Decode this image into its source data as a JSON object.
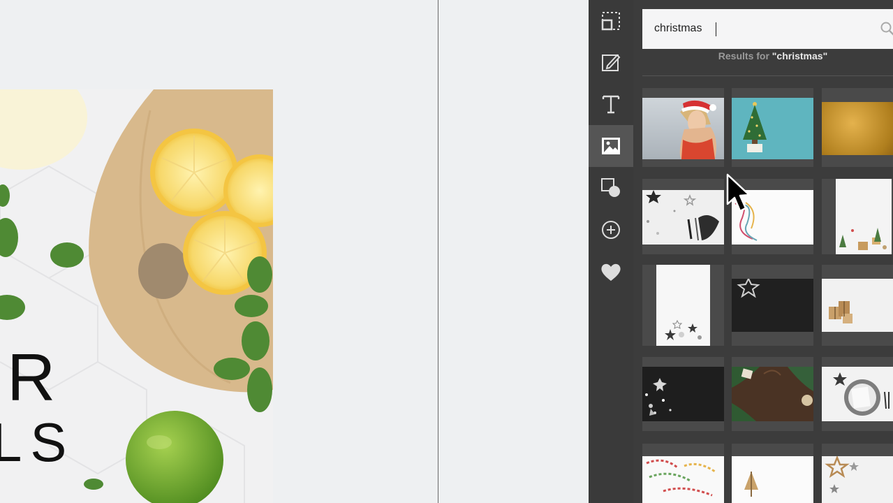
{
  "design": {
    "letter_r": "R",
    "letters_ls": "LS"
  },
  "toolbar": {
    "tools": [
      "resize",
      "edit",
      "text",
      "photos",
      "shapes",
      "add",
      "favorites"
    ],
    "active": "photos"
  },
  "panel": {
    "search": {
      "value": "christmas",
      "placeholder": ""
    },
    "results_prefix": "Results for",
    "results_query": "\"christmas\""
  },
  "colors": {
    "rail": "#3a3a3a",
    "panel": "#3c3c3c",
    "active_tool": "#555555",
    "canvas": "#eef0f2"
  }
}
